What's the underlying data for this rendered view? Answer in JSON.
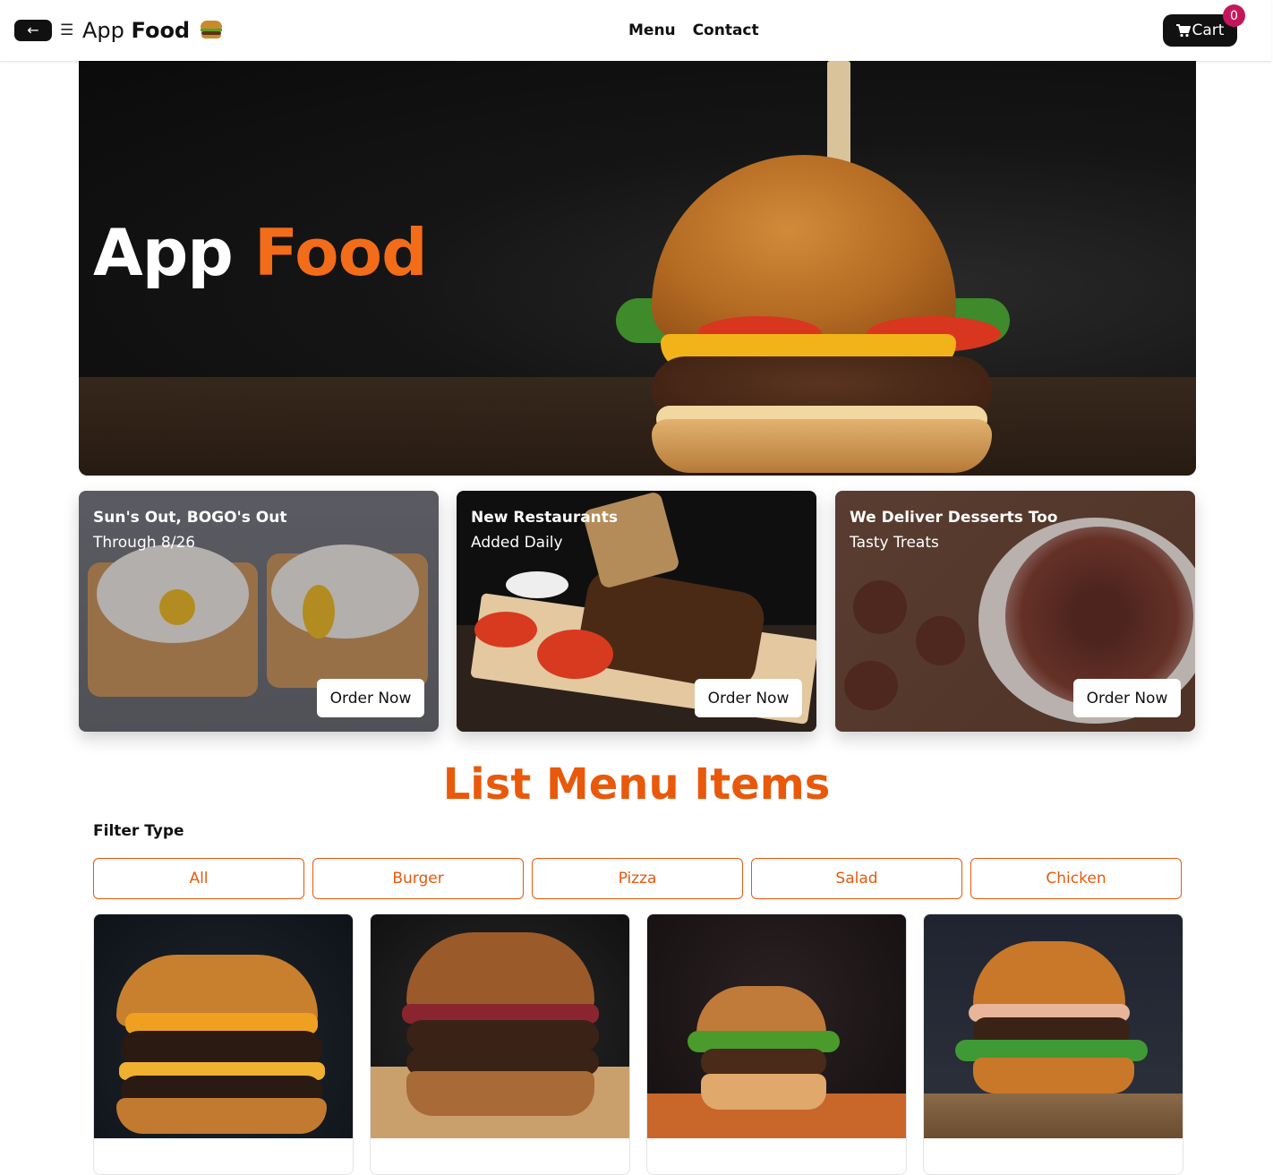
{
  "navbar": {
    "back_icon": "←",
    "menu_icon": "☰",
    "brand_plain": "App",
    "brand_bold": "Food",
    "links": [
      "Menu",
      "Contact"
    ],
    "cart_label": "Cart",
    "cart_count": "0"
  },
  "hero": {
    "title_plain": "App",
    "title_accent": "Food"
  },
  "promos": [
    {
      "title": "Sun's Out, BOGO's Out",
      "subtitle": "Through 8/26",
      "button": "Order Now"
    },
    {
      "title": "New Restaurants",
      "subtitle": "Added Daily",
      "button": "Order Now"
    },
    {
      "title": "We Deliver Desserts Too",
      "subtitle": "Tasty Treats",
      "button": "Order Now"
    }
  ],
  "menu_section": {
    "title": "List Menu Items",
    "filter_label": "Filter Type",
    "filters": [
      "All",
      "Burger",
      "Pizza",
      "Salad",
      "Chicken"
    ]
  },
  "colors": {
    "accent": "#e8590c",
    "hero_accent": "#f36c1a",
    "badge": "#c2185b",
    "dark_button": "#111111"
  }
}
